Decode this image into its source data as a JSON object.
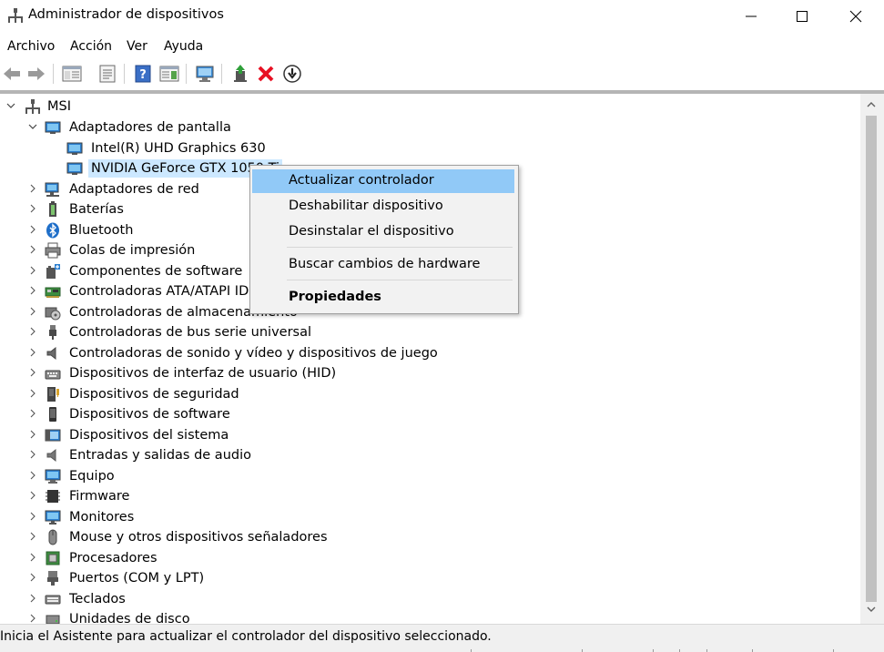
{
  "window": {
    "title": "Administrador de dispositivos"
  },
  "menu": [
    "Archivo",
    "Acción",
    "Ver",
    "Ayuda"
  ],
  "tree": {
    "root": "MSI",
    "items": [
      {
        "label": "Adaptadores de pantalla",
        "icon": "display-adapter-icon"
      },
      {
        "label": "Intel(R) UHD Graphics 630",
        "icon": "display-adapter-icon"
      },
      {
        "label": "NVIDIA GeForce GTX 1050 Ti",
        "icon": "display-adapter-icon"
      },
      {
        "label": "Adaptadores de red",
        "icon": "network-adapter-icon"
      },
      {
        "label": "Baterías",
        "icon": "battery-icon"
      },
      {
        "label": "Bluetooth",
        "icon": "bluetooth-icon"
      },
      {
        "label": "Colas de impresión",
        "icon": "printer-icon"
      },
      {
        "label": "Componentes de software",
        "icon": "software-component-icon"
      },
      {
        "label": "Controladoras ATA/ATAPI IDE",
        "icon": "ide-controller-icon"
      },
      {
        "label": "Controladoras de almacenamiento",
        "icon": "storage-controller-icon"
      },
      {
        "label": "Controladoras de bus serie universal",
        "icon": "usb-icon"
      },
      {
        "label": "Controladoras de sonido y vídeo y dispositivos de juego",
        "icon": "speaker-icon"
      },
      {
        "label": "Dispositivos de interfaz de usuario (HID)",
        "icon": "hid-icon"
      },
      {
        "label": "Dispositivos de seguridad",
        "icon": "security-device-icon"
      },
      {
        "label": "Dispositivos de software",
        "icon": "software-device-icon"
      },
      {
        "label": "Dispositivos del sistema",
        "icon": "system-device-icon"
      },
      {
        "label": "Entradas y salidas de audio",
        "icon": "audio-io-icon"
      },
      {
        "label": "Equipo",
        "icon": "computer-icon"
      },
      {
        "label": "Firmware",
        "icon": "firmware-icon"
      },
      {
        "label": "Monitores",
        "icon": "monitor-icon"
      },
      {
        "label": "Mouse y otros dispositivos señaladores",
        "icon": "mouse-icon"
      },
      {
        "label": "Procesadores",
        "icon": "processor-icon"
      },
      {
        "label": "Puertos (COM y LPT)",
        "icon": "port-icon"
      },
      {
        "label": "Teclados",
        "icon": "keyboard-icon"
      },
      {
        "label": "Unidades de disco",
        "icon": "disk-drive-icon"
      }
    ]
  },
  "context_menu": {
    "items": [
      "Actualizar controlador",
      "Deshabilitar dispositivo",
      "Desinstalar el dispositivo",
      "Buscar cambios de hardware",
      "Propiedades"
    ]
  },
  "status": {
    "text": "Inicia el Asistente para actualizar el controlador del dispositivo seleccionado."
  },
  "colors": {
    "selection": "#cce8ff",
    "menu_highlight": "#91c9f7",
    "remove": "#e81123"
  }
}
